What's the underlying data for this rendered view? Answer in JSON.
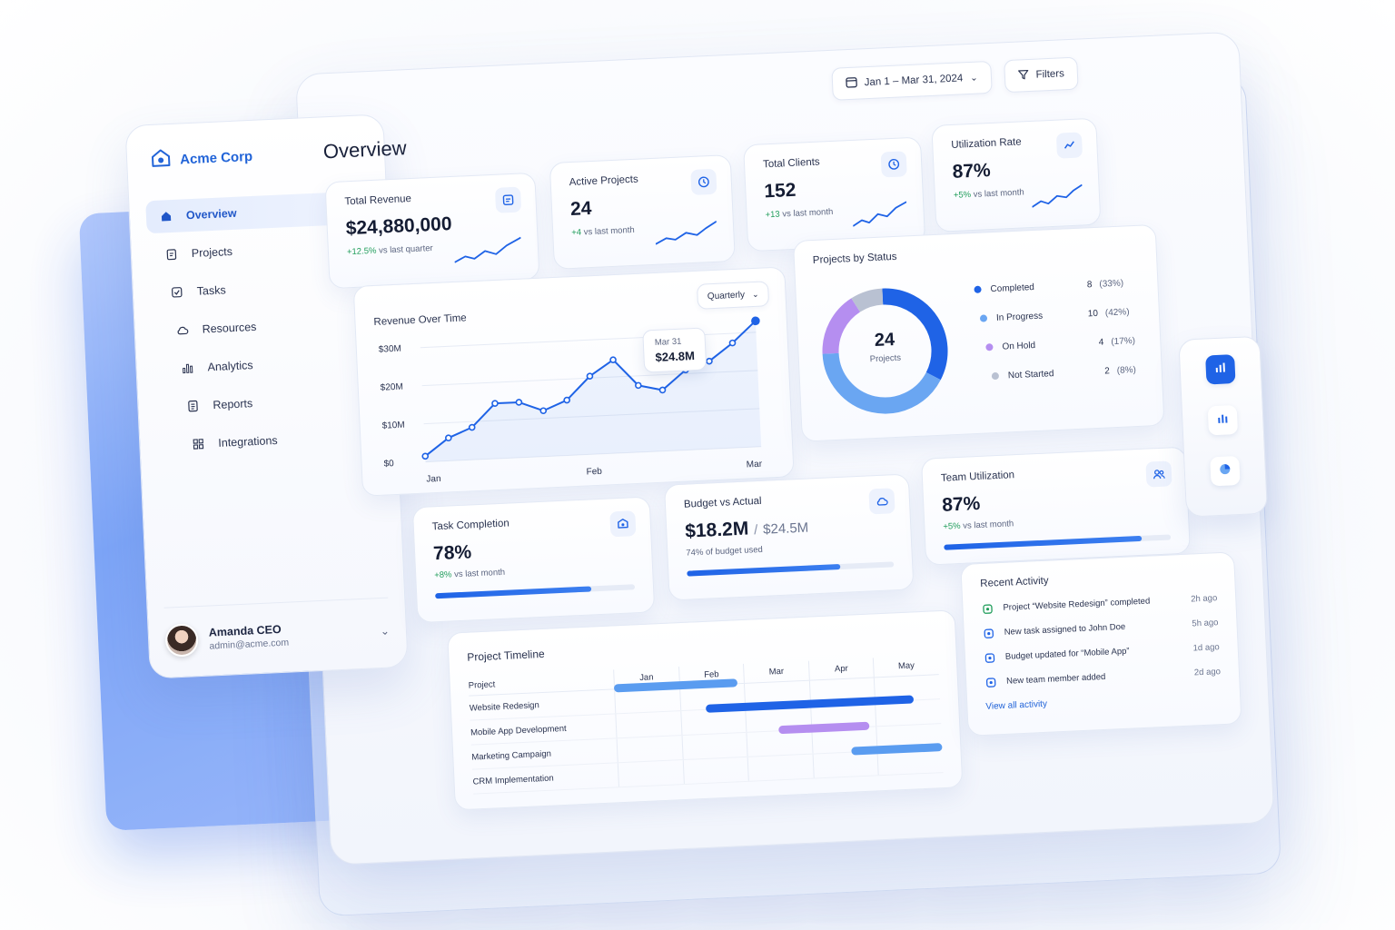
{
  "brand": {
    "name": "Acme Corp"
  },
  "page": {
    "title": "Overview"
  },
  "toolbar": {
    "date_range": "Jan 1 – Mar 31, 2024",
    "filters_label": "Filters"
  },
  "sidebar": {
    "items": [
      {
        "label": "Overview",
        "icon": "home-icon",
        "active": true
      },
      {
        "label": "Projects",
        "icon": "clipboard-icon"
      },
      {
        "label": "Tasks",
        "icon": "checkbox-icon"
      },
      {
        "label": "Resources",
        "icon": "cloud-icon"
      },
      {
        "label": "Analytics",
        "icon": "bar-chart-icon"
      },
      {
        "label": "Reports",
        "icon": "document-icon"
      },
      {
        "label": "Integrations",
        "icon": "grid-icon"
      }
    ],
    "user": {
      "name": "Amanda CEO",
      "email": "admin@acme.com"
    }
  },
  "kpis": {
    "revenue": {
      "title": "Total Revenue",
      "value": "$24,880,000",
      "delta": "+12.5%",
      "delta_suffix": "vs last quarter"
    },
    "projects": {
      "title": "Active Projects",
      "value": "24",
      "delta": "+4",
      "delta_suffix": "vs last month"
    },
    "clients": {
      "title": "Total Clients",
      "value": "152",
      "delta": "+13",
      "delta_suffix": "vs last month"
    },
    "utilization": {
      "title": "Utilization Rate",
      "value": "87%",
      "delta": "+5%",
      "delta_suffix": "vs last month"
    }
  },
  "revenue_chart": {
    "title": "Revenue Over Time",
    "period": "Quarterly",
    "tooltip": {
      "date": "Mar 31",
      "value": "$24.8M"
    }
  },
  "status": {
    "title": "Projects by Status",
    "center_value": "24",
    "center_label": "Projects",
    "items": [
      {
        "label": "Completed",
        "count": "8",
        "pct": "(33%)",
        "color": "#1f63e6"
      },
      {
        "label": "In Progress",
        "count": "10",
        "pct": "(42%)",
        "color": "#6aa6f2"
      },
      {
        "label": "On Hold",
        "count": "4",
        "pct": "(17%)",
        "color": "#b58ef0"
      },
      {
        "label": "Not Started",
        "count": "2",
        "pct": "(8%)",
        "color": "#b9c1d2"
      }
    ]
  },
  "task_completion": {
    "title": "Task Completion",
    "value": "78%",
    "delta": "+8%",
    "delta_suffix": "vs last month",
    "progress": 0.78
  },
  "budget": {
    "title": "Budget vs Actual",
    "actual": "$18.2M",
    "separator": "/",
    "budget": "$24.5M",
    "note": "74% of budget used",
    "progress": 0.74
  },
  "team_util": {
    "title": "Team Utilization",
    "value": "87%",
    "delta": "+5%",
    "delta_suffix": "vs last month",
    "progress": 0.87
  },
  "timeline": {
    "title": "Project Timeline",
    "header_label": "Project",
    "months": [
      "Jan",
      "Feb",
      "Mar",
      "Apr",
      "May"
    ],
    "rows": [
      {
        "name": "Website Redesign",
        "start": 0.0,
        "end": 0.38,
        "color": "#5a9cf0"
      },
      {
        "name": "Mobile App Development",
        "start": 0.28,
        "end": 0.92,
        "color": "#1f63e6"
      },
      {
        "name": "Marketing Campaign",
        "start": 0.5,
        "end": 0.78,
        "color": "#b58ef0"
      },
      {
        "name": "CRM Implementation",
        "start": 0.72,
        "end": 1.0,
        "color": "#5a9cf0"
      }
    ]
  },
  "activity": {
    "title": "Recent Activity",
    "items": [
      {
        "text": "Project “Website Redesign” completed",
        "time": "2h ago",
        "icon": "check-circle-icon",
        "color": "#1f9d5a"
      },
      {
        "text": "New task assigned to John Doe",
        "time": "5h ago",
        "icon": "task-icon",
        "color": "#1f63e6"
      },
      {
        "text": "Budget updated for “Mobile App”",
        "time": "1d ago",
        "icon": "budget-icon",
        "color": "#1f63e6"
      },
      {
        "text": "New team member added",
        "time": "2d ago",
        "icon": "user-add-icon",
        "color": "#1f63e6"
      }
    ],
    "link": "View all activity"
  },
  "chart_data": {
    "type": "line",
    "title": "Revenue Over Time",
    "x_tick_labels": [
      "Jan",
      "Feb",
      "Mar"
    ],
    "y_tick_labels": [
      "$0",
      "$10M",
      "$20M",
      "$30M"
    ],
    "ylim": [
      0,
      30
    ],
    "y_unit": "$M",
    "series": [
      {
        "values": [
          1.5,
          6.0,
          8.5,
          14.5,
          14.5,
          12.0,
          14.5,
          20.5,
          24.5,
          17.5,
          16.0,
          21.0,
          23.0,
          27.5,
          33.0
        ]
      }
    ],
    "grid": true,
    "color": "#1f63e6"
  }
}
